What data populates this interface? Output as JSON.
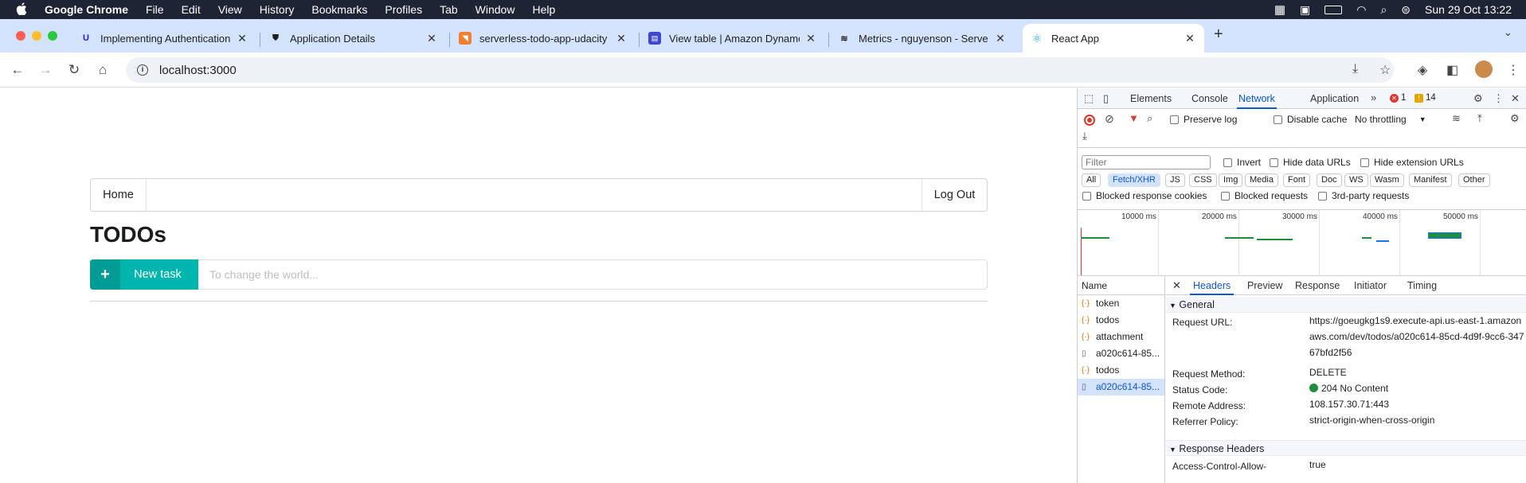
{
  "menubar": {
    "app": "Google Chrome",
    "items": [
      "File",
      "Edit",
      "View",
      "History",
      "Bookmarks",
      "Profiles",
      "Tab",
      "Window",
      "Help"
    ],
    "clock": "Sun 29 Oct  13:22"
  },
  "tabs": [
    {
      "title": "Implementing Authentication",
      "icon": "udacity-icon"
    },
    {
      "title": "Application Details",
      "icon": "auth0-shield-icon"
    },
    {
      "title": "serverless-todo-app-udacity",
      "icon": "rss-icon"
    },
    {
      "title": "View table | Amazon Dynamo",
      "icon": "dynamodb-icon"
    },
    {
      "title": "Metrics - nguyenson - Serve",
      "icon": "serverless-icon"
    },
    {
      "title": "React App",
      "icon": "react-icon"
    }
  ],
  "address": {
    "url": "localhost:3000"
  },
  "app": {
    "home_label": "Home",
    "logout_label": "Log Out",
    "heading": "TODOs",
    "new_task_label": "New task",
    "task_placeholder": "To change the world..."
  },
  "devtools": {
    "panels": [
      "Elements",
      "Console",
      "Network",
      "Application"
    ],
    "active_panel": "Network",
    "error_count": "1",
    "warning_count": "14",
    "preserve_log": "Preserve log",
    "disable_cache": "Disable cache",
    "throttling": "No throttling",
    "filter_placeholder": "Filter",
    "invert": "Invert",
    "hide_data_urls": "Hide data URLs",
    "hide_extension_urls": "Hide extension URLs",
    "types": [
      "All",
      "Fetch/XHR",
      "JS",
      "CSS",
      "Img",
      "Media",
      "Font",
      "Doc",
      "WS",
      "Wasm",
      "Manifest",
      "Other"
    ],
    "active_type": "Fetch/XHR",
    "blocked_cookies": "Blocked response cookies",
    "blocked_requests": "Blocked requests",
    "third_party": "3rd-party requests",
    "timeline_labels": [
      "10000 ms",
      "20000 ms",
      "30000 ms",
      "40000 ms",
      "50000 ms"
    ],
    "name_header": "Name",
    "requests": [
      {
        "name": "token",
        "kind": "fetch"
      },
      {
        "name": "todos",
        "kind": "fetch"
      },
      {
        "name": "attachment",
        "kind": "fetch"
      },
      {
        "name": "a020c614-85...",
        "kind": "doc"
      },
      {
        "name": "todos",
        "kind": "fetch"
      },
      {
        "name": "a020c614-85...",
        "kind": "doc",
        "selected": true
      }
    ],
    "detail_tabs": [
      "Headers",
      "Preview",
      "Response",
      "Initiator",
      "Timing"
    ],
    "active_detail_tab": "Headers",
    "general_title": "General",
    "general": {
      "request_url_key": "Request URL:",
      "request_url": "https://goeugkg1s9.execute-api.us-east-1.amazonaws.com/dev/todos/a020c614-85cd-4d9f-9cc6-34767bfd2f56",
      "method_key": "Request Method:",
      "method": "DELETE",
      "status_key": "Status Code:",
      "status": "204 No Content",
      "remote_key": "Remote Address:",
      "remote": "108.157.30.71:443",
      "referrer_key": "Referrer Policy:",
      "referrer": "strict-origin-when-cross-origin"
    },
    "response_headers_title": "Response Headers",
    "response_headers": {
      "acao_key": "Access-Control-Allow-",
      "acao_val": "true"
    }
  }
}
